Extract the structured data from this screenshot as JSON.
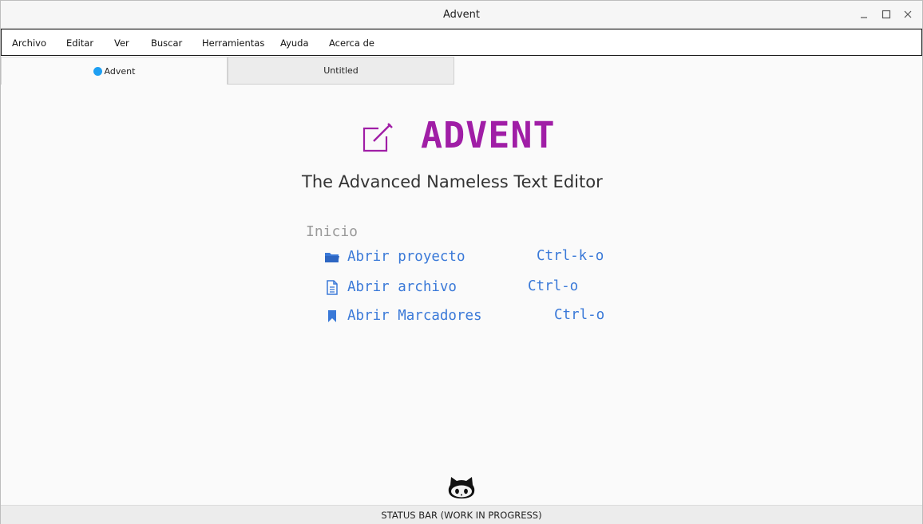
{
  "window": {
    "title": "Advent"
  },
  "menu": [
    "Archivo",
    "Editar",
    "Ver",
    "Buscar",
    "Herramientas",
    "Ayuda",
    "Acerca de"
  ],
  "tabs": [
    {
      "label": "Advent",
      "active": true
    },
    {
      "label": "Untitled",
      "active": false
    }
  ],
  "hero": {
    "logo_text": "ADVENT",
    "subtitle": "The Advanced Nameless Text Editor"
  },
  "start": {
    "heading": "Inicio",
    "actions": [
      {
        "label": "Abrir proyecto",
        "shortcut": "Ctrl-k-o",
        "icon": "folder-icon"
      },
      {
        "label": "Abrir archivo",
        "shortcut": "Ctrl-o",
        "icon": "document-icon"
      },
      {
        "label": "Abrir Marcadores",
        "shortcut": "Ctrl-o",
        "icon": "bookmark-icon"
      }
    ]
  },
  "status_bar": {
    "text": "STATUS BAR (WORK IN PROGRESS)"
  },
  "colors": {
    "accent": "#a01ea6",
    "link": "#3a79d8",
    "tab_dot": "#1e9ff2"
  }
}
